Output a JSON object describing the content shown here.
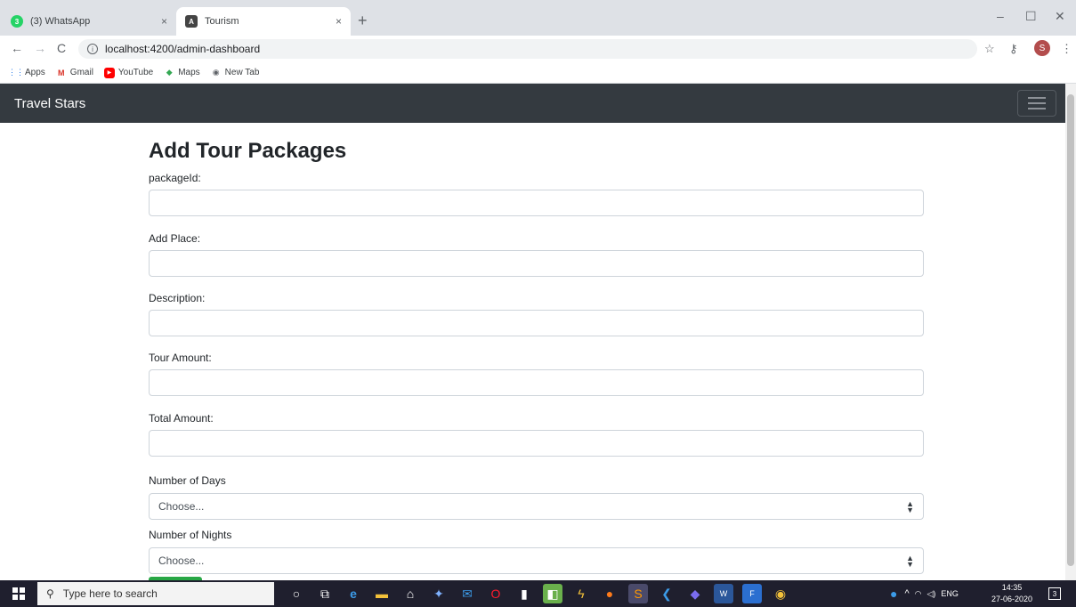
{
  "browser": {
    "tabs": [
      {
        "label": "(3) WhatsApp",
        "close": "×"
      },
      {
        "label": "Tourism",
        "close": "×"
      }
    ],
    "new_tab": "+",
    "url": "localhost:4200/admin-dashboard",
    "bookmarks": [
      "Apps",
      "Gmail",
      "YouTube",
      "Maps",
      "New Tab"
    ],
    "profile_initial": "S"
  },
  "navbar": {
    "brand": "Travel Stars"
  },
  "form": {
    "title": "Add Tour Packages",
    "fields": [
      {
        "label": "packageId:",
        "value": ""
      },
      {
        "label": "Add Place:",
        "value": ""
      },
      {
        "label": "Description:",
        "value": ""
      },
      {
        "label": "Tour Amount:",
        "value": ""
      },
      {
        "label": "Total Amount:",
        "value": ""
      }
    ],
    "selects": [
      {
        "label": "Number of Days",
        "value": "Choose..."
      },
      {
        "label": "Number of Nights",
        "value": "Choose..."
      }
    ]
  },
  "taskbar": {
    "search_placeholder": "Type here to search",
    "language": "ENG",
    "time": "14:35",
    "date": "27-06-2020",
    "notifications": "3"
  },
  "colors": {
    "navbar_bg": "#343a40",
    "submit_green": "#28a745",
    "taskbar_bg": "#1f1f2e"
  }
}
